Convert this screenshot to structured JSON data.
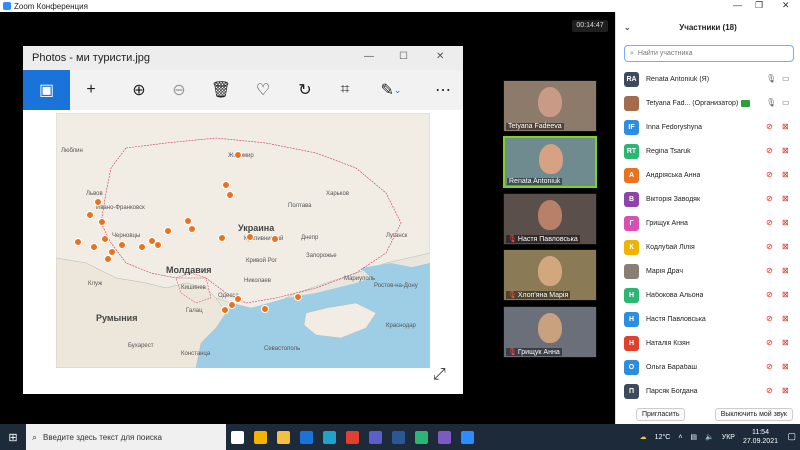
{
  "zoom": {
    "title": "Zoom Конференция",
    "timer": "00:14:47"
  },
  "photos": {
    "title": "Photos - ми туристи.jpg",
    "toolbar": [
      "image-icon",
      "add-icon",
      "zoom-in-icon",
      "zoom-out-icon",
      "delete-icon",
      "heart-icon",
      "rotate-icon",
      "crop-icon",
      "edit-icon",
      "more-icon"
    ]
  },
  "map": {
    "labels": [
      {
        "text": "Люблин"
      },
      {
        "text": "Житомир"
      },
      {
        "text": "Харьков"
      },
      {
        "text": "Львов"
      },
      {
        "text": "Ивано-Франковск"
      },
      {
        "text": "Украина"
      },
      {
        "text": "Полтава"
      },
      {
        "text": "Днепр"
      },
      {
        "text": "Кропивницкий"
      },
      {
        "text": "Кривой Рог"
      },
      {
        "text": "Запорожье"
      },
      {
        "text": "Луганск"
      },
      {
        "text": "Молдавия"
      },
      {
        "text": "Кишинев"
      },
      {
        "text": "Николаев"
      },
      {
        "text": "Мариуполь"
      },
      {
        "text": "Ростов-на-Дону"
      },
      {
        "text": "Клуж"
      },
      {
        "text": "Румыния"
      },
      {
        "text": "Одесса"
      },
      {
        "text": "Галац"
      },
      {
        "text": "Бухарест"
      },
      {
        "text": "Севастополь"
      },
      {
        "text": "Констанца"
      },
      {
        "text": "Краснодар"
      },
      {
        "text": "Черновцы"
      }
    ]
  },
  "videos": [
    {
      "name": "Tetyana Fadeeva",
      "muted": false,
      "active": false,
      "skin": "#c99a86",
      "bg": "#8c7a6b"
    },
    {
      "name": "Renata Antoniuk",
      "muted": false,
      "active": true,
      "skin": "#d7a184",
      "bg": "#6f8b8f"
    },
    {
      "name": "Настя Павловська",
      "muted": true,
      "active": false,
      "skin": "#b88068",
      "bg": "#5a4f4b"
    },
    {
      "name": "Хлоп'яна Марія",
      "muted": true,
      "active": false,
      "skin": "#d3a77e",
      "bg": "#8a7a55"
    },
    {
      "name": "Грищук Анна",
      "muted": true,
      "active": false,
      "skin": "#c9a17e",
      "bg": "#6b6f7a"
    }
  ],
  "participants": {
    "title": "Участники (18)",
    "search_placeholder": "Найти участника",
    "items": [
      {
        "initials": "RA",
        "name": "Renata Antoniuk (Я)",
        "color": "#3d4b5c",
        "photo": false,
        "host": false,
        "mic": "on",
        "cam": "on"
      },
      {
        "initials": "",
        "name": "Tetyana Fad... (Организатор)",
        "color": "#a56b4d",
        "photo": true,
        "host": true,
        "mic": "on",
        "cam": "on"
      },
      {
        "initials": "IF",
        "name": "Inna Fedoryshyna",
        "color": "#2d8ee0",
        "photo": false,
        "host": false,
        "mic": "off",
        "cam": "off"
      },
      {
        "initials": "RT",
        "name": "Regina Tsaruk",
        "color": "#2bb673",
        "photo": false,
        "host": false,
        "mic": "off",
        "cam": "off"
      },
      {
        "initials": "А",
        "name": "Андріяська Анна",
        "color": "#e8731f",
        "photo": false,
        "host": false,
        "mic": "off",
        "cam": "off"
      },
      {
        "initials": "В",
        "name": "Вікторія Заводяк",
        "color": "#8e44ad",
        "photo": false,
        "host": false,
        "mic": "off",
        "cam": "off"
      },
      {
        "initials": "Г",
        "name": "Грищук Анна",
        "color": "#d94fb6",
        "photo": false,
        "host": false,
        "mic": "off",
        "cam": "off"
      },
      {
        "initials": "К",
        "name": "Кодлубай Лілія",
        "color": "#f0b400",
        "photo": false,
        "host": false,
        "mic": "off",
        "cam": "off"
      },
      {
        "initials": "",
        "name": "Марія Драч",
        "color": "#8a7f73",
        "photo": true,
        "host": false,
        "mic": "off",
        "cam": "off"
      },
      {
        "initials": "Н",
        "name": "Набокова Альона",
        "color": "#2bb673",
        "photo": false,
        "host": false,
        "mic": "off",
        "cam": "off"
      },
      {
        "initials": "Н",
        "name": "Настя Павловська",
        "color": "#2d8ee0",
        "photo": false,
        "host": false,
        "mic": "off",
        "cam": "off"
      },
      {
        "initials": "Н",
        "name": "Наталія Кізян",
        "color": "#e0402d",
        "photo": false,
        "host": false,
        "mic": "off",
        "cam": "off"
      },
      {
        "initials": "О",
        "name": "Ольга Барабаш",
        "color": "#2d8ee0",
        "photo": false,
        "host": false,
        "mic": "off",
        "cam": "off"
      },
      {
        "initials": "П",
        "name": "Парсяк Богдана",
        "color": "#3d4b5c",
        "photo": false,
        "host": false,
        "mic": "off",
        "cam": "off"
      }
    ],
    "invite_label": "Пригласить",
    "mute_all_label": "Выключить мой звук"
  },
  "taskbar": {
    "search_placeholder": "Введите здесь текст для поиска",
    "apps": [
      {
        "name": "task-view-icon",
        "color": "#ffffff"
      },
      {
        "name": "store-icon",
        "color": "#f3b400"
      },
      {
        "name": "explorer-icon",
        "color": "#f5c042"
      },
      {
        "name": "mail-icon",
        "color": "#1a73d8"
      },
      {
        "name": "edge-icon",
        "color": "#1fa3c9"
      },
      {
        "name": "chrome-icon",
        "color": "#e0402d"
      },
      {
        "name": "teams-icon",
        "color": "#5b5fc7"
      },
      {
        "name": "word-icon",
        "color": "#2b5797"
      },
      {
        "name": "maps-icon",
        "color": "#2bb673"
      },
      {
        "name": "viber-icon",
        "color": "#7c5ac2"
      },
      {
        "name": "zoom-icon",
        "color": "#2d8cff"
      }
    ],
    "weather": "12°C",
    "lang": "УКР",
    "time": "11:54",
    "date": "27.09.2021"
  }
}
